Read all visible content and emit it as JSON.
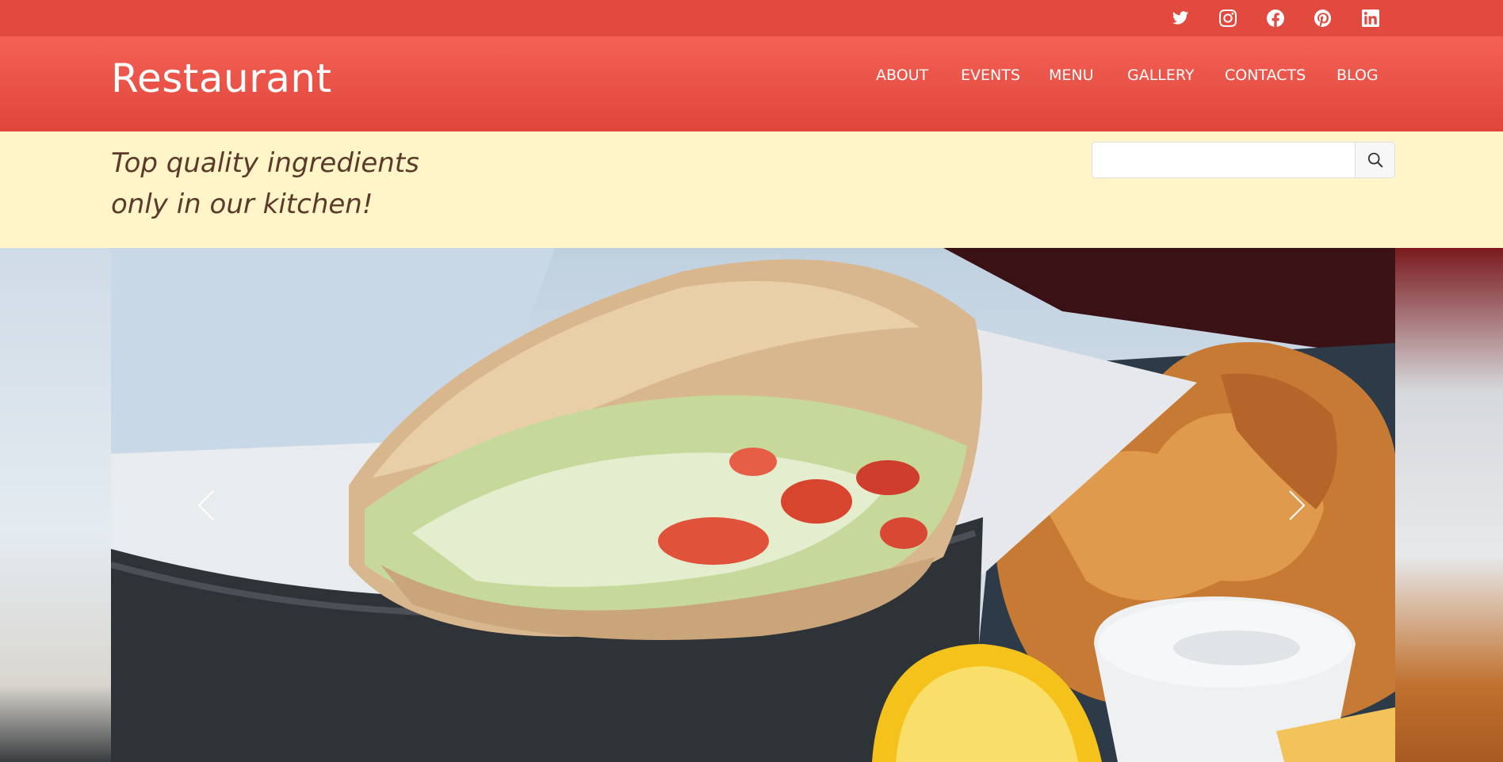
{
  "social": {
    "items": [
      {
        "name": "twitter-icon"
      },
      {
        "name": "instagram-icon"
      },
      {
        "name": "facebook-icon"
      },
      {
        "name": "pinterest-icon"
      },
      {
        "name": "linkedin-icon"
      }
    ]
  },
  "header": {
    "logo": "Restaurant",
    "nav": [
      "ABOUT",
      "EVENTS",
      "MENU",
      "GALLERY",
      "CONTACTS",
      "BLOG"
    ]
  },
  "band": {
    "tagline_line1": "Top quality ingredients",
    "tagline_line2": "only in our kitchen!",
    "search_value": "",
    "search_placeholder": ""
  },
  "slider": {
    "prev_icon": "chevron-left-icon",
    "next_icon": "chevron-right-icon"
  },
  "colors": {
    "topbar": "#e24a3f",
    "header": "#ef5448",
    "band": "#fff5c9",
    "tagline": "#5b3a2a"
  }
}
